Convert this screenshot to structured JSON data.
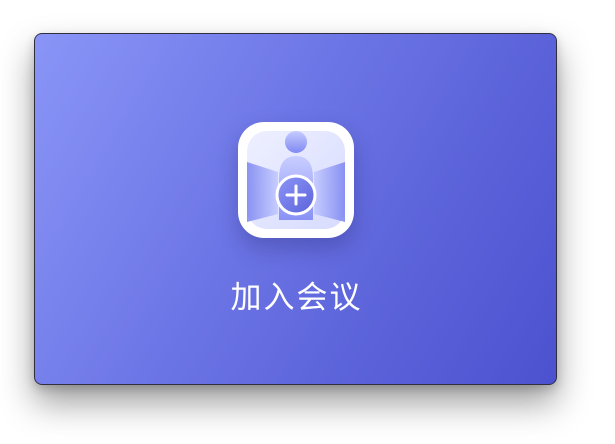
{
  "join_card": {
    "label": "加入会议",
    "icon": "join-meeting-icon",
    "colors": {
      "gradient_start": "#8a95f7",
      "gradient_end": "#4c52cf",
      "label_color": "#ffffff",
      "icon_background": "#ffffff"
    }
  }
}
